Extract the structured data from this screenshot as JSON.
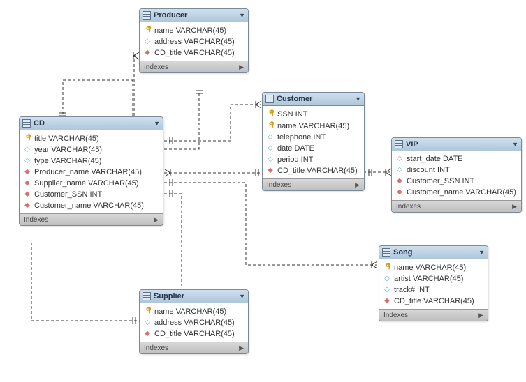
{
  "indexes_label": "Indexes",
  "entities": {
    "cd": {
      "title": "CD",
      "fields": [
        {
          "sym": "key",
          "label": "title VARCHAR(45)"
        },
        {
          "sym": "opt",
          "label": "year VARCHAR(45)"
        },
        {
          "sym": "opt",
          "label": "type VARCHAR(45)"
        },
        {
          "sym": "fk",
          "label": "Producer_name VARCHAR(45)"
        },
        {
          "sym": "fk",
          "label": "Supplier_name VARCHAR(45)"
        },
        {
          "sym": "fk",
          "label": "Customer_SSN INT"
        },
        {
          "sym": "fk",
          "label": "Customer_name VARCHAR(45)"
        }
      ]
    },
    "producer": {
      "title": "Producer",
      "fields": [
        {
          "sym": "key",
          "label": "name VARCHAR(45)"
        },
        {
          "sym": "opt",
          "label": "address VARCHAR(45)"
        },
        {
          "sym": "fk",
          "label": "CD_title VARCHAR(45)"
        }
      ]
    },
    "customer": {
      "title": "Customer",
      "fields": [
        {
          "sym": "key",
          "label": "SSN INT"
        },
        {
          "sym": "key",
          "label": "name VARCHAR(45)"
        },
        {
          "sym": "opt",
          "label": "telephone INT"
        },
        {
          "sym": "opt",
          "label": "date DATE"
        },
        {
          "sym": "opt",
          "label": "period INT"
        },
        {
          "sym": "fk",
          "label": "CD_title VARCHAR(45)"
        }
      ]
    },
    "vip": {
      "title": "VIP",
      "fields": [
        {
          "sym": "opt",
          "label": "start_date DATE"
        },
        {
          "sym": "opt",
          "label": "discount INT"
        },
        {
          "sym": "fk",
          "label": "Customer_SSN INT"
        },
        {
          "sym": "fk",
          "label": "Customer_name VARCHAR(45)"
        }
      ]
    },
    "song": {
      "title": "Song",
      "fields": [
        {
          "sym": "key",
          "label": "name VARCHAR(45)"
        },
        {
          "sym": "opt",
          "label": "artist VARCHAR(45)"
        },
        {
          "sym": "opt",
          "label": "track# INT"
        },
        {
          "sym": "fk",
          "label": "CD_title VARCHAR(45)"
        }
      ]
    },
    "supplier": {
      "title": "Supplier",
      "fields": [
        {
          "sym": "key",
          "label": "name VARCHAR(45)"
        },
        {
          "sym": "opt",
          "label": "address VARCHAR(45)"
        },
        {
          "sym": "fk",
          "label": "CD_title VARCHAR(45)"
        }
      ]
    }
  }
}
